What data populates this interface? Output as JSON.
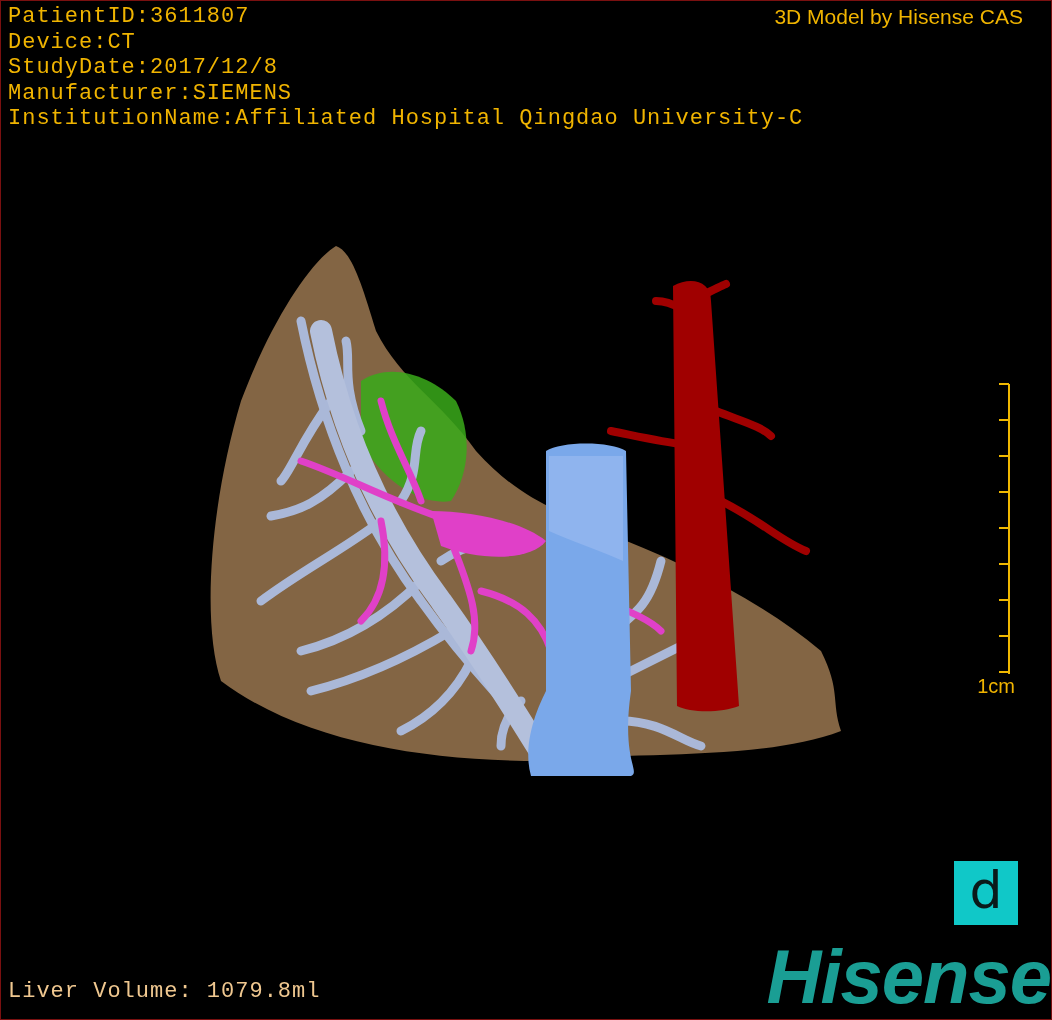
{
  "patient_info": [
    "PatientID:3611807",
    "Device:CT",
    "StudyDate:2017/12/8",
    "Manufacturer:SIEMENS",
    "InstitutionName:Affiliated Hospital Qingdao University-C"
  ],
  "model_credit": "3D Model by Hisense CAS",
  "scale_bar": {
    "label": "1cm"
  },
  "liver_volume": "Liver Volume: 1079.8ml",
  "badge": {
    "glyph": "d"
  },
  "logo": "Hisense"
}
